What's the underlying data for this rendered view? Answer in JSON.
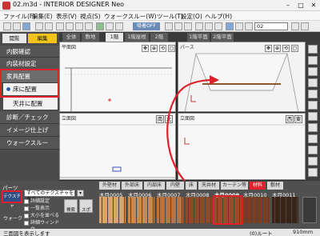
{
  "window": {
    "title": "02.m3d - INTERIOR DESIGNER Neo",
    "min": "–",
    "max": "□",
    "close": "✕"
  },
  "menu": [
    "ファイル(F)",
    "編集(E)",
    "表示(V)",
    "視点(S)",
    "ウォークスルー(W)",
    "ツール(T)",
    "設定(O)",
    "ヘルプ(H)"
  ],
  "toolbar": {
    "snap_label": "吸着OFF",
    "floor_value": "02"
  },
  "left_panel": {
    "mode_buttons": [
      "閲覧",
      "編集"
    ],
    "items": [
      "内観確認",
      "内装材設定",
      "家具配置",
      "天井に配置",
      "診断／チェック",
      "イメージ仕上げ",
      "ウォークスルー"
    ],
    "active_sub": "床に配置"
  },
  "view_tabs": [
    "全体",
    "敷地",
    "1階",
    "1階屋根",
    "2階",
    "1階平面",
    "2階平面"
  ],
  "views": {
    "plan_label": "平面図",
    "perspective_label": "パース",
    "elevation_left_label": "立面図",
    "elevation_right_label": "立面図",
    "dir_south": "南",
    "dir_north": "北",
    "dir_west": "西",
    "dir_east": "東"
  },
  "parts": {
    "title": "パーツ",
    "texture_button": "テクスチャ",
    "walk_label": "ウォーク",
    "filter": "すべてのテクスチャを表示",
    "check_detail": "詳細設定",
    "check_1": "一覧表示",
    "check_2": "大小を並べる",
    "check_3": "詳細ウィンドウ",
    "btn_search": "検索",
    "btn_spoit": "スポイト",
    "material_tabs": [
      "外壁材",
      "外部床",
      "内部床",
      "内壁",
      "床",
      "天井材",
      "カーテン等",
      "材料",
      "敷材"
    ],
    "swatch_labels": [
      "木目0005",
      "木目0006",
      "木目0007",
      "木目0008",
      "木目0009",
      "木目0010",
      "木目0011"
    ]
  },
  "colors": {
    "highlight": "#e0202a",
    "swatches": [
      "#d9a36a",
      "#c98a4f",
      "#b57442",
      "#8c4a27",
      "#9a4b2a",
      "#7a3f23",
      "#3a2418"
    ]
  },
  "status": {
    "left": "三面図を表示します",
    "right": "(0)ルート",
    "unit": "910mm"
  }
}
